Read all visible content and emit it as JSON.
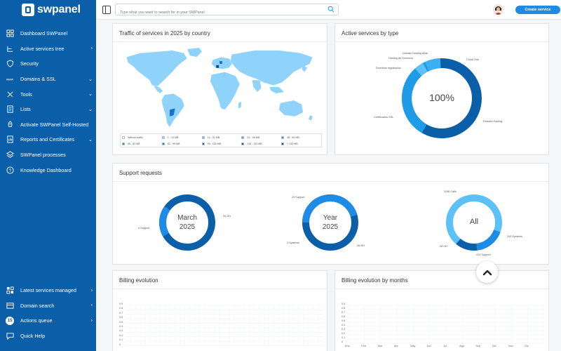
{
  "app": {
    "logo_text": "swpanel"
  },
  "sidebar": {
    "items": [
      {
        "label": "Dashboard SWPanel",
        "icon": "dashboard-icon",
        "chevron": ""
      },
      {
        "label": "Active services tree",
        "icon": "tree-icon",
        "chevron": "›"
      },
      {
        "label": "Security",
        "icon": "shield-icon",
        "chevron": ""
      },
      {
        "label": "Domains & SSL",
        "icon": "www-icon",
        "chevron": "⌄"
      },
      {
        "label": "Tools",
        "icon": "tools-icon",
        "chevron": "⌄"
      },
      {
        "label": "Lists",
        "icon": "list-icon",
        "chevron": "⌄"
      },
      {
        "label": "Activate SWPanel Self-Hosted",
        "icon": "rocket-icon",
        "chevron": ""
      },
      {
        "label": "Reports and Certificates",
        "icon": "report-icon",
        "chevron": "⌄"
      },
      {
        "label": "SWPanel processes",
        "icon": "layers-icon",
        "chevron": ""
      },
      {
        "label": "Knowledge Dashboard",
        "icon": "help-icon",
        "chevron": ""
      }
    ],
    "bottom": [
      {
        "label": "Latest services managed",
        "icon": "grid-icon",
        "chevron": "›"
      },
      {
        "label": "Domain search",
        "icon": "globe-icon",
        "chevron": "›"
      },
      {
        "label": "Actions queue",
        "badge": "15",
        "chevron": "›"
      },
      {
        "label": "Quick Help",
        "icon": "chat-icon",
        "chevron": ""
      }
    ]
  },
  "topbar": {
    "search_placeholder": "Type what you want to search for in your SWPanel",
    "create_label": "Create service"
  },
  "traffic": {
    "title": "Traffic of services in 2025 by country",
    "legend": [
      {
        "label": "Without traffic",
        "color": "#ffffff"
      },
      {
        "label": "1 - 14 MB",
        "color": "#8fd3fb"
      },
      {
        "label": "14 - 31 MB",
        "color": "#5cc1f7"
      },
      {
        "label": "31 - 48 MB",
        "color": "#3ab0f1"
      },
      {
        "label": "48 - 65 MB",
        "color": "#1e9ce8"
      },
      {
        "label": "65 - 82 MB",
        "color": "#1889da"
      },
      {
        "label": "82 - 99 MB",
        "color": "#1476c7"
      },
      {
        "label": "99 - 116 MB",
        "color": "#0f64b4"
      },
      {
        "label": "116 - 133 MB",
        "color": "#0b55a1"
      },
      {
        "label": "> 133 MB",
        "color": "#08468c"
      }
    ]
  },
  "active_services": {
    "title": "Active services by type",
    "center": "100%",
    "labels": [
      "Domain Hosting Alias",
      "Hosting de Dominios",
      "Cloud One",
      "Dominios registrados",
      "Certificados SSL",
      "Domain Hosting"
    ]
  },
  "support": {
    "title": "Support requests",
    "donuts": [
      {
        "line1": "March",
        "line2": "2025",
        "labels": [
          "26 OH",
          "6 Support"
        ]
      },
      {
        "line1": "Year",
        "line2": "2025",
        "labels": [
          "24 Support",
          "2 Systems",
          "26 OH"
        ]
      },
      {
        "line1": "All",
        "line2": "",
        "labels": [
          "1196 Calls",
          "243 Systems",
          "414 Support",
          "28 OH"
        ]
      }
    ]
  },
  "billing": {
    "title": "Billing evolution",
    "y_ticks": [
      "0.9",
      "0.8",
      "0.7",
      "0.6",
      "0.5",
      "0.4",
      "0.3",
      "0.2",
      "0.1",
      "0"
    ]
  },
  "billing_months": {
    "title": "Billing evolution by months",
    "y_ticks": [
      "0.9",
      "0.8",
      "0.7",
      "0.6",
      "0.5",
      "0.4",
      "0.3",
      "0.2",
      "0.1",
      "0"
    ],
    "months": [
      "Ene",
      "Feb",
      "Mar",
      "Abr",
      "May",
      "Jun",
      "Jul",
      "Ago",
      "Sep",
      "Oct",
      "Nov",
      "Dic"
    ]
  }
}
